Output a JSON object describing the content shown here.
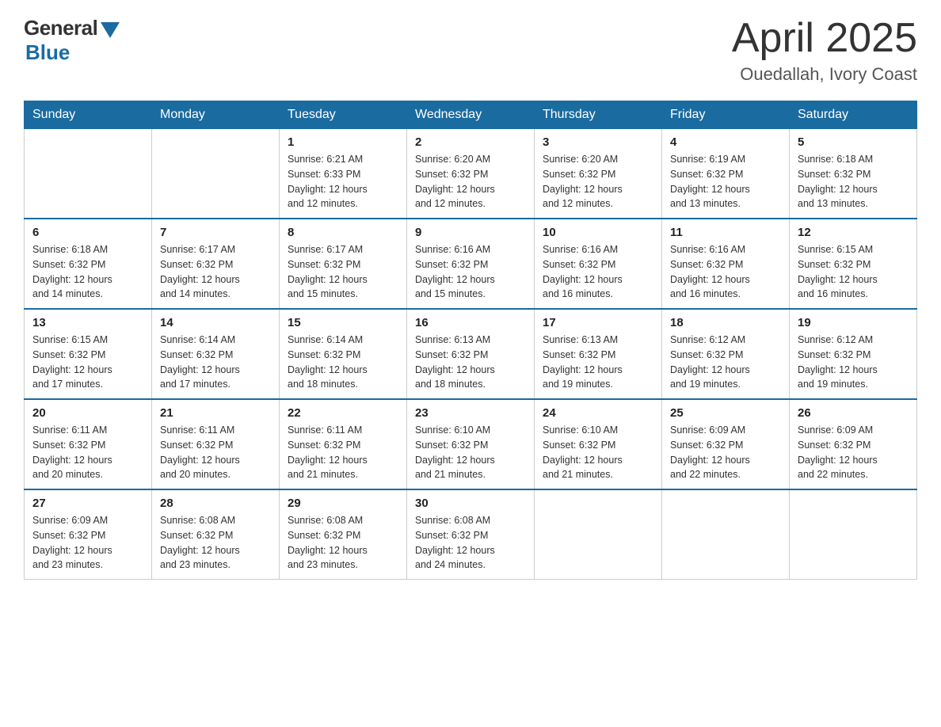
{
  "header": {
    "logo_general": "General",
    "logo_blue": "Blue",
    "month_year": "April 2025",
    "location": "Ouedallah, Ivory Coast"
  },
  "days_of_week": [
    "Sunday",
    "Monday",
    "Tuesday",
    "Wednesday",
    "Thursday",
    "Friday",
    "Saturday"
  ],
  "weeks": [
    [
      {
        "day": "",
        "info": ""
      },
      {
        "day": "",
        "info": ""
      },
      {
        "day": "1",
        "info": "Sunrise: 6:21 AM\nSunset: 6:33 PM\nDaylight: 12 hours\nand 12 minutes."
      },
      {
        "day": "2",
        "info": "Sunrise: 6:20 AM\nSunset: 6:32 PM\nDaylight: 12 hours\nand 12 minutes."
      },
      {
        "day": "3",
        "info": "Sunrise: 6:20 AM\nSunset: 6:32 PM\nDaylight: 12 hours\nand 12 minutes."
      },
      {
        "day": "4",
        "info": "Sunrise: 6:19 AM\nSunset: 6:32 PM\nDaylight: 12 hours\nand 13 minutes."
      },
      {
        "day": "5",
        "info": "Sunrise: 6:18 AM\nSunset: 6:32 PM\nDaylight: 12 hours\nand 13 minutes."
      }
    ],
    [
      {
        "day": "6",
        "info": "Sunrise: 6:18 AM\nSunset: 6:32 PM\nDaylight: 12 hours\nand 14 minutes."
      },
      {
        "day": "7",
        "info": "Sunrise: 6:17 AM\nSunset: 6:32 PM\nDaylight: 12 hours\nand 14 minutes."
      },
      {
        "day": "8",
        "info": "Sunrise: 6:17 AM\nSunset: 6:32 PM\nDaylight: 12 hours\nand 15 minutes."
      },
      {
        "day": "9",
        "info": "Sunrise: 6:16 AM\nSunset: 6:32 PM\nDaylight: 12 hours\nand 15 minutes."
      },
      {
        "day": "10",
        "info": "Sunrise: 6:16 AM\nSunset: 6:32 PM\nDaylight: 12 hours\nand 16 minutes."
      },
      {
        "day": "11",
        "info": "Sunrise: 6:16 AM\nSunset: 6:32 PM\nDaylight: 12 hours\nand 16 minutes."
      },
      {
        "day": "12",
        "info": "Sunrise: 6:15 AM\nSunset: 6:32 PM\nDaylight: 12 hours\nand 16 minutes."
      }
    ],
    [
      {
        "day": "13",
        "info": "Sunrise: 6:15 AM\nSunset: 6:32 PM\nDaylight: 12 hours\nand 17 minutes."
      },
      {
        "day": "14",
        "info": "Sunrise: 6:14 AM\nSunset: 6:32 PM\nDaylight: 12 hours\nand 17 minutes."
      },
      {
        "day": "15",
        "info": "Sunrise: 6:14 AM\nSunset: 6:32 PM\nDaylight: 12 hours\nand 18 minutes."
      },
      {
        "day": "16",
        "info": "Sunrise: 6:13 AM\nSunset: 6:32 PM\nDaylight: 12 hours\nand 18 minutes."
      },
      {
        "day": "17",
        "info": "Sunrise: 6:13 AM\nSunset: 6:32 PM\nDaylight: 12 hours\nand 19 minutes."
      },
      {
        "day": "18",
        "info": "Sunrise: 6:12 AM\nSunset: 6:32 PM\nDaylight: 12 hours\nand 19 minutes."
      },
      {
        "day": "19",
        "info": "Sunrise: 6:12 AM\nSunset: 6:32 PM\nDaylight: 12 hours\nand 19 minutes."
      }
    ],
    [
      {
        "day": "20",
        "info": "Sunrise: 6:11 AM\nSunset: 6:32 PM\nDaylight: 12 hours\nand 20 minutes."
      },
      {
        "day": "21",
        "info": "Sunrise: 6:11 AM\nSunset: 6:32 PM\nDaylight: 12 hours\nand 20 minutes."
      },
      {
        "day": "22",
        "info": "Sunrise: 6:11 AM\nSunset: 6:32 PM\nDaylight: 12 hours\nand 21 minutes."
      },
      {
        "day": "23",
        "info": "Sunrise: 6:10 AM\nSunset: 6:32 PM\nDaylight: 12 hours\nand 21 minutes."
      },
      {
        "day": "24",
        "info": "Sunrise: 6:10 AM\nSunset: 6:32 PM\nDaylight: 12 hours\nand 21 minutes."
      },
      {
        "day": "25",
        "info": "Sunrise: 6:09 AM\nSunset: 6:32 PM\nDaylight: 12 hours\nand 22 minutes."
      },
      {
        "day": "26",
        "info": "Sunrise: 6:09 AM\nSunset: 6:32 PM\nDaylight: 12 hours\nand 22 minutes."
      }
    ],
    [
      {
        "day": "27",
        "info": "Sunrise: 6:09 AM\nSunset: 6:32 PM\nDaylight: 12 hours\nand 23 minutes."
      },
      {
        "day": "28",
        "info": "Sunrise: 6:08 AM\nSunset: 6:32 PM\nDaylight: 12 hours\nand 23 minutes."
      },
      {
        "day": "29",
        "info": "Sunrise: 6:08 AM\nSunset: 6:32 PM\nDaylight: 12 hours\nand 23 minutes."
      },
      {
        "day": "30",
        "info": "Sunrise: 6:08 AM\nSunset: 6:32 PM\nDaylight: 12 hours\nand 24 minutes."
      },
      {
        "day": "",
        "info": ""
      },
      {
        "day": "",
        "info": ""
      },
      {
        "day": "",
        "info": ""
      }
    ]
  ]
}
